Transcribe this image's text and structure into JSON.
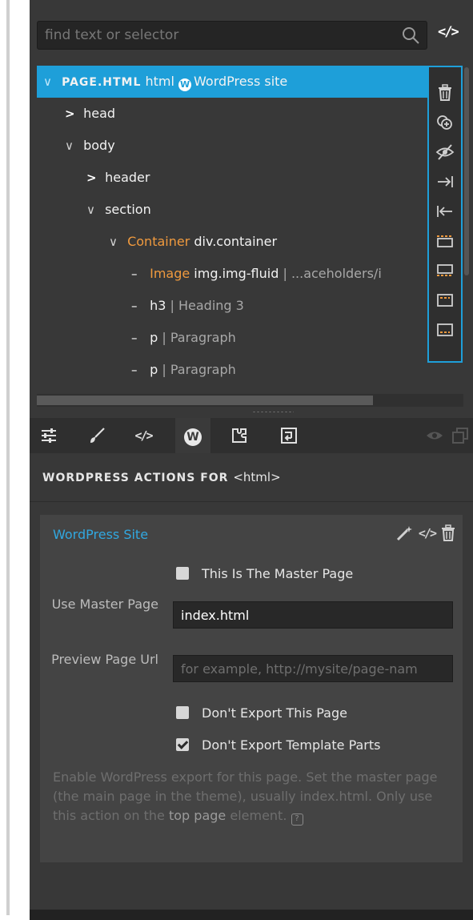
{
  "search": {
    "placeholder": "find text or selector",
    "code_toggle": "</>"
  },
  "tree": {
    "rows": [
      {
        "label": "PAGE.HTML",
        "tag": "html",
        "extra": "WordPress site"
      },
      {
        "label": "head"
      },
      {
        "label": "body"
      },
      {
        "label": "header"
      },
      {
        "label": "section"
      },
      {
        "name": "Container",
        "label": "div.container"
      },
      {
        "name": "Image",
        "label": "img.img-fluid",
        "extra": "...aceholders/i"
      },
      {
        "label": "h3",
        "extra": "Heading 3"
      },
      {
        "label": "p",
        "extra": "Paragraph"
      },
      {
        "label": "p",
        "extra": "Paragraph"
      }
    ],
    "separator": "|"
  },
  "panel": {
    "heading": "WORDPRESS ACTIONS FOR",
    "heading_tag": "<html>",
    "card": {
      "title": "WordPress Site",
      "master_page_checkbox": "This Is The Master Page",
      "use_master_label": "Use Master Page",
      "use_master_value": "index.html",
      "preview_label": "Preview Page Url",
      "preview_placeholder": "for example, http://mysite/page-nam",
      "dont_export_page": "Don't Export This Page",
      "dont_export_parts": "Don't Export Template Parts",
      "help_1": "Enable WordPress export for this page. Set the master page (the main page in the theme), usually index.html. Only use this action on the",
      "help_link": "top page",
      "help_2": "element."
    },
    "checkbox_states": {
      "master": false,
      "export_page": false,
      "export_parts": true
    }
  },
  "colors": {
    "accent": "#1e9fd9",
    "orange": "#f09a3e",
    "panel_bg": "#383838"
  }
}
